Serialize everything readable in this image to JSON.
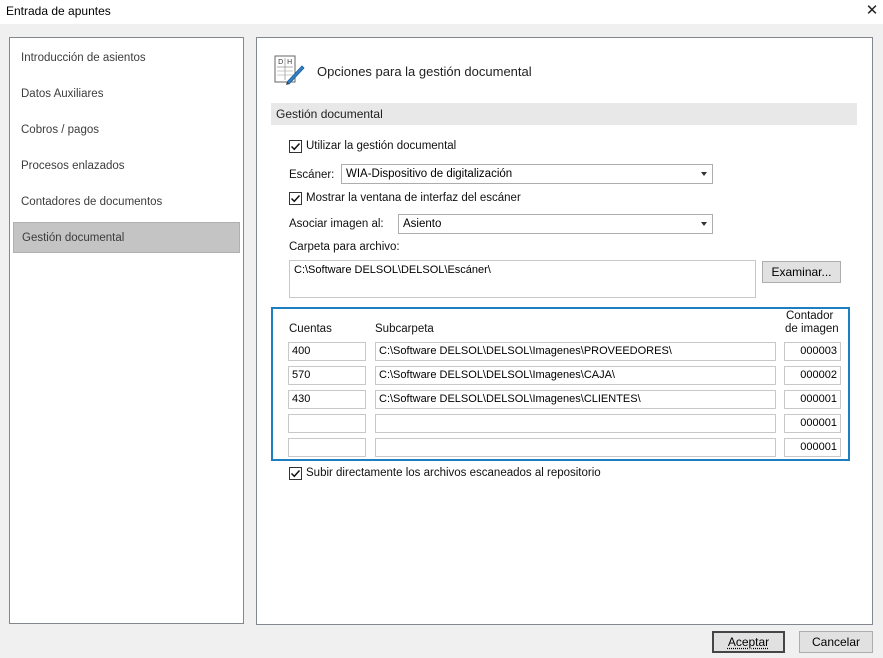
{
  "window": {
    "title": "Entrada de apuntes",
    "close_glyph": "✕"
  },
  "sidebar": {
    "items": [
      {
        "label": "Introducción de asientos"
      },
      {
        "label": "Datos Auxiliares"
      },
      {
        "label": "Cobros / pagos"
      },
      {
        "label": "Procesos enlazados"
      },
      {
        "label": "Contadores de documentos"
      },
      {
        "label": "Gestión documental"
      }
    ],
    "selected_index": 5
  },
  "content": {
    "title": "Opciones para la gestión documental",
    "icon": "document-pen-icon",
    "section_title": "Gestión documental",
    "use_docs": {
      "label": "Utilizar la gestión documental",
      "checked": true
    },
    "scanner": {
      "label": "Escáner:",
      "value": "WIA-Dispositivo de digitalización"
    },
    "show_scanner_ui": {
      "label": "Mostrar la ventana de interfaz del escáner",
      "checked": true
    },
    "associate": {
      "label": "Asociar imagen al:",
      "value": "Asiento"
    },
    "folder": {
      "label": "Carpeta para archivo:",
      "value": "C:\\Software DELSOL\\DELSOL\\Escáner\\",
      "browse_label": "Examinar..."
    },
    "table": {
      "headers": {
        "accounts": "Cuentas",
        "subfolder": "Subcarpeta",
        "counter_line1": "Contador",
        "counter_line2": "de imagen"
      },
      "rows": [
        {
          "account": "400",
          "subfolder": "C:\\Software DELSOL\\DELSOL\\Imagenes\\PROVEEDORES\\",
          "counter": "000003"
        },
        {
          "account": "570",
          "subfolder": "C:\\Software DELSOL\\DELSOL\\Imagenes\\CAJA\\",
          "counter": "000002"
        },
        {
          "account": "430",
          "subfolder": "C:\\Software DELSOL\\DELSOL\\Imagenes\\CLIENTES\\",
          "counter": "000001"
        },
        {
          "account": "",
          "subfolder": "",
          "counter": "000001"
        },
        {
          "account": "",
          "subfolder": "",
          "counter": "000001"
        }
      ]
    },
    "upload": {
      "label": "Subir directamente los archivos escaneados al repositorio",
      "checked": true
    }
  },
  "footer": {
    "accept_label": "Aceptar",
    "cancel_label": "Cancelar"
  },
  "colors": {
    "accent_border": "#1d7fc2",
    "selected_nav": "#c4c4c4"
  }
}
